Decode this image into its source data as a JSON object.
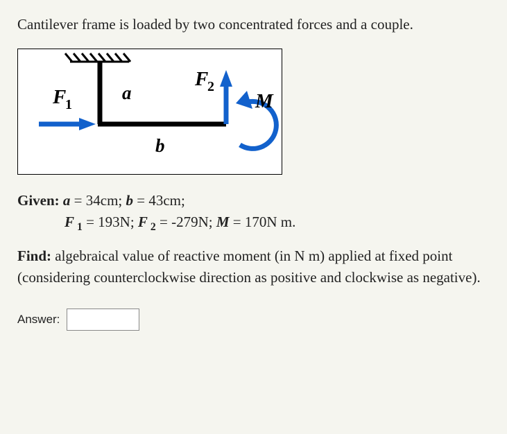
{
  "intro": "Cantilever frame is loaded by two concentrated forces and a couple.",
  "diagram": {
    "F1": "F",
    "F1_sub": "1",
    "F2": "F",
    "F2_sub": "2",
    "M": "M",
    "a": "a",
    "b": "b"
  },
  "given": {
    "label": "Given:",
    "line1_a": "a",
    "line1_a_val": " = 34cm; ",
    "line1_b": "b",
    "line1_b_val": " = 43cm;",
    "line2_F1": "F",
    "line2_F1_sub": " 1",
    "line2_F1_val": " =  193N; ",
    "line2_F2": "F",
    "line2_F2_sub": " 2",
    "line2_F2_val": " =  -279N; ",
    "line2_M": "M",
    "line2_M_val": " =  170N m."
  },
  "find": {
    "label": "Find:",
    "text": "  algebraical value of reactive moment  (in N m)  applied at fixed point (considering counterclockwise direction as positive and clockwise as negative)."
  },
  "answer": {
    "label": "Answer:",
    "value": ""
  }
}
